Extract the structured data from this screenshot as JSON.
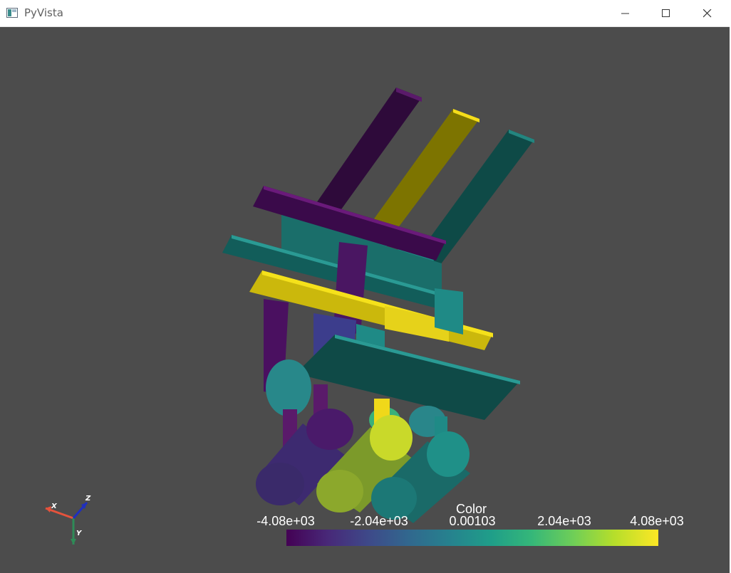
{
  "window": {
    "title": "PyVista",
    "icon": "pyvista-window-icon",
    "controls": [
      "minimize-icon",
      "maximize-icon",
      "close-icon"
    ]
  },
  "viewport": {
    "background": "#4c4c4c"
  },
  "axes_widget": {
    "x_label": "X",
    "y_label": "Y",
    "z_label": "Z",
    "x_color": "#e5533c",
    "y_color": "#2e8b57",
    "z_color": "#1f2fbf"
  },
  "scalar_bar": {
    "title": "Color",
    "ticks": [
      "-4.08e+03",
      "-2.04e+03",
      "0.00103",
      "2.04e+03",
      "4.08e+03"
    ],
    "colormap": "viridis",
    "range": [
      -4080,
      4080
    ]
  }
}
